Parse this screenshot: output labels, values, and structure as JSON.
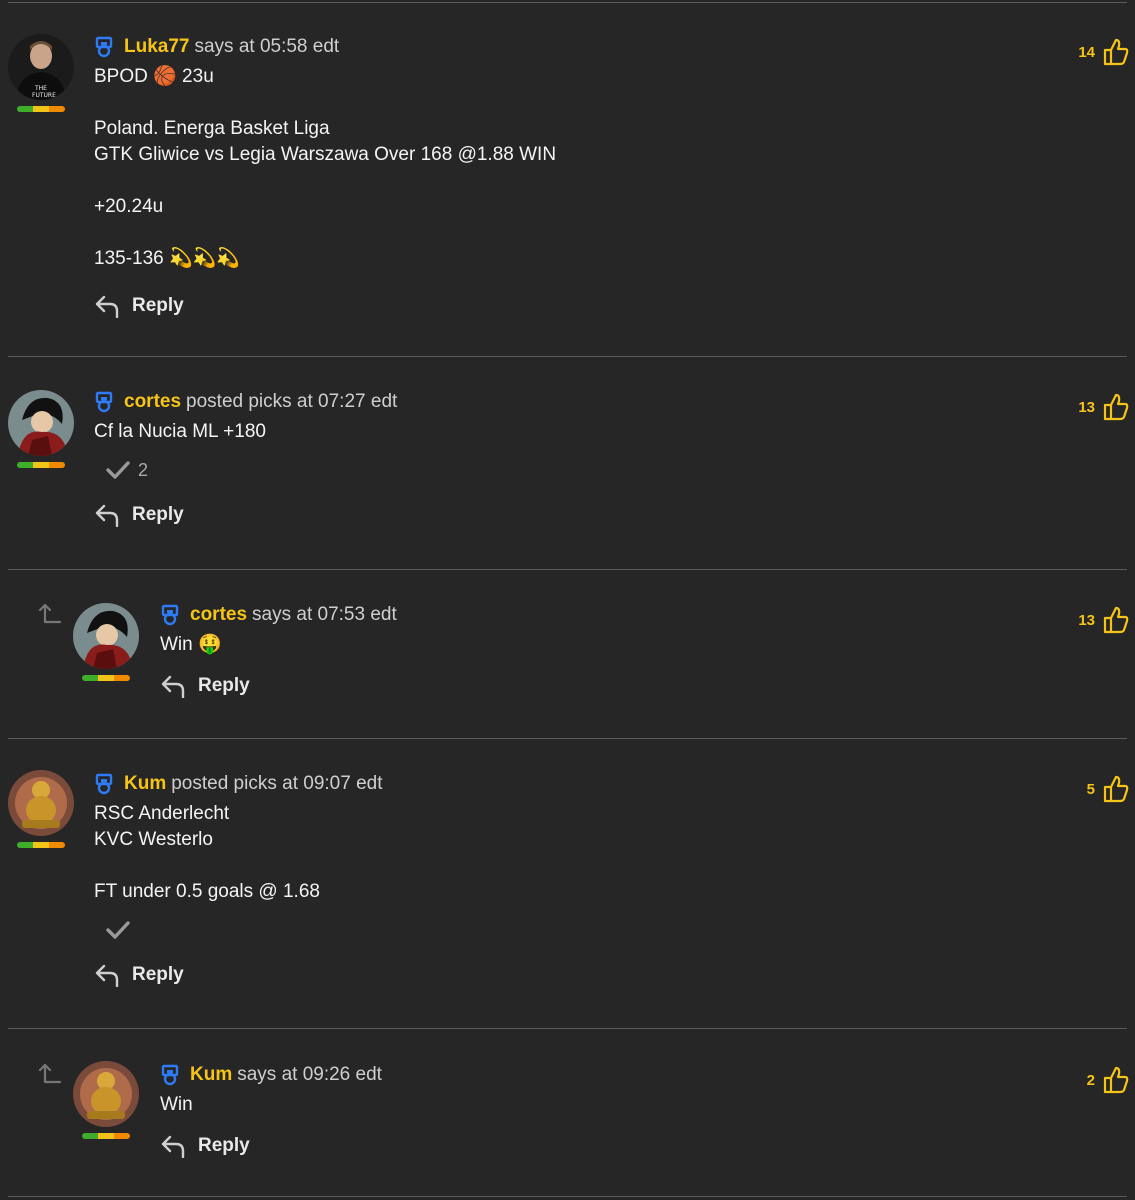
{
  "colors": {
    "accent": "#f6c417",
    "badge": "#2f7bf5",
    "background": "#262626"
  },
  "icons": {
    "badge": "trophy-badge-icon",
    "reply": "reply-arrow-icon",
    "like": "thumbs-up-icon",
    "check": "checkmark-icon",
    "thread": "thread-indent-arrow-icon"
  },
  "comments": [
    {
      "user": "Luka77",
      "meta": "says at 05:58 edt",
      "text": "BPOD 🏀 23u\n\nPoland. Energa Basket Liga\nGTK Gliwice vs Legia Warszawa Over 168 @1.88 WIN\n\n+20.24u\n\n135-136 💫💫💫",
      "likes": "14",
      "reply": "Reply"
    },
    {
      "user": "cortes",
      "meta": "posted picks at 07:27 edt",
      "text": "Cf la Nucia ML +180",
      "check_count": "2",
      "likes": "13",
      "reply": "Reply"
    },
    {
      "user": "cortes",
      "meta": "says at 07:53 edt",
      "text": "Win 🤑",
      "likes": "13",
      "reply": "Reply"
    },
    {
      "user": "Kum",
      "meta": "posted picks at 09:07 edt",
      "text": "RSC Anderlecht\nKVC Westerlo\n\nFT under 0.5 goals @ 1.68",
      "check_count": "",
      "likes": "5",
      "reply": "Reply"
    },
    {
      "user": "Kum",
      "meta": "says at 09:26 edt",
      "text": "Win",
      "likes": "2",
      "reply": "Reply"
    }
  ]
}
